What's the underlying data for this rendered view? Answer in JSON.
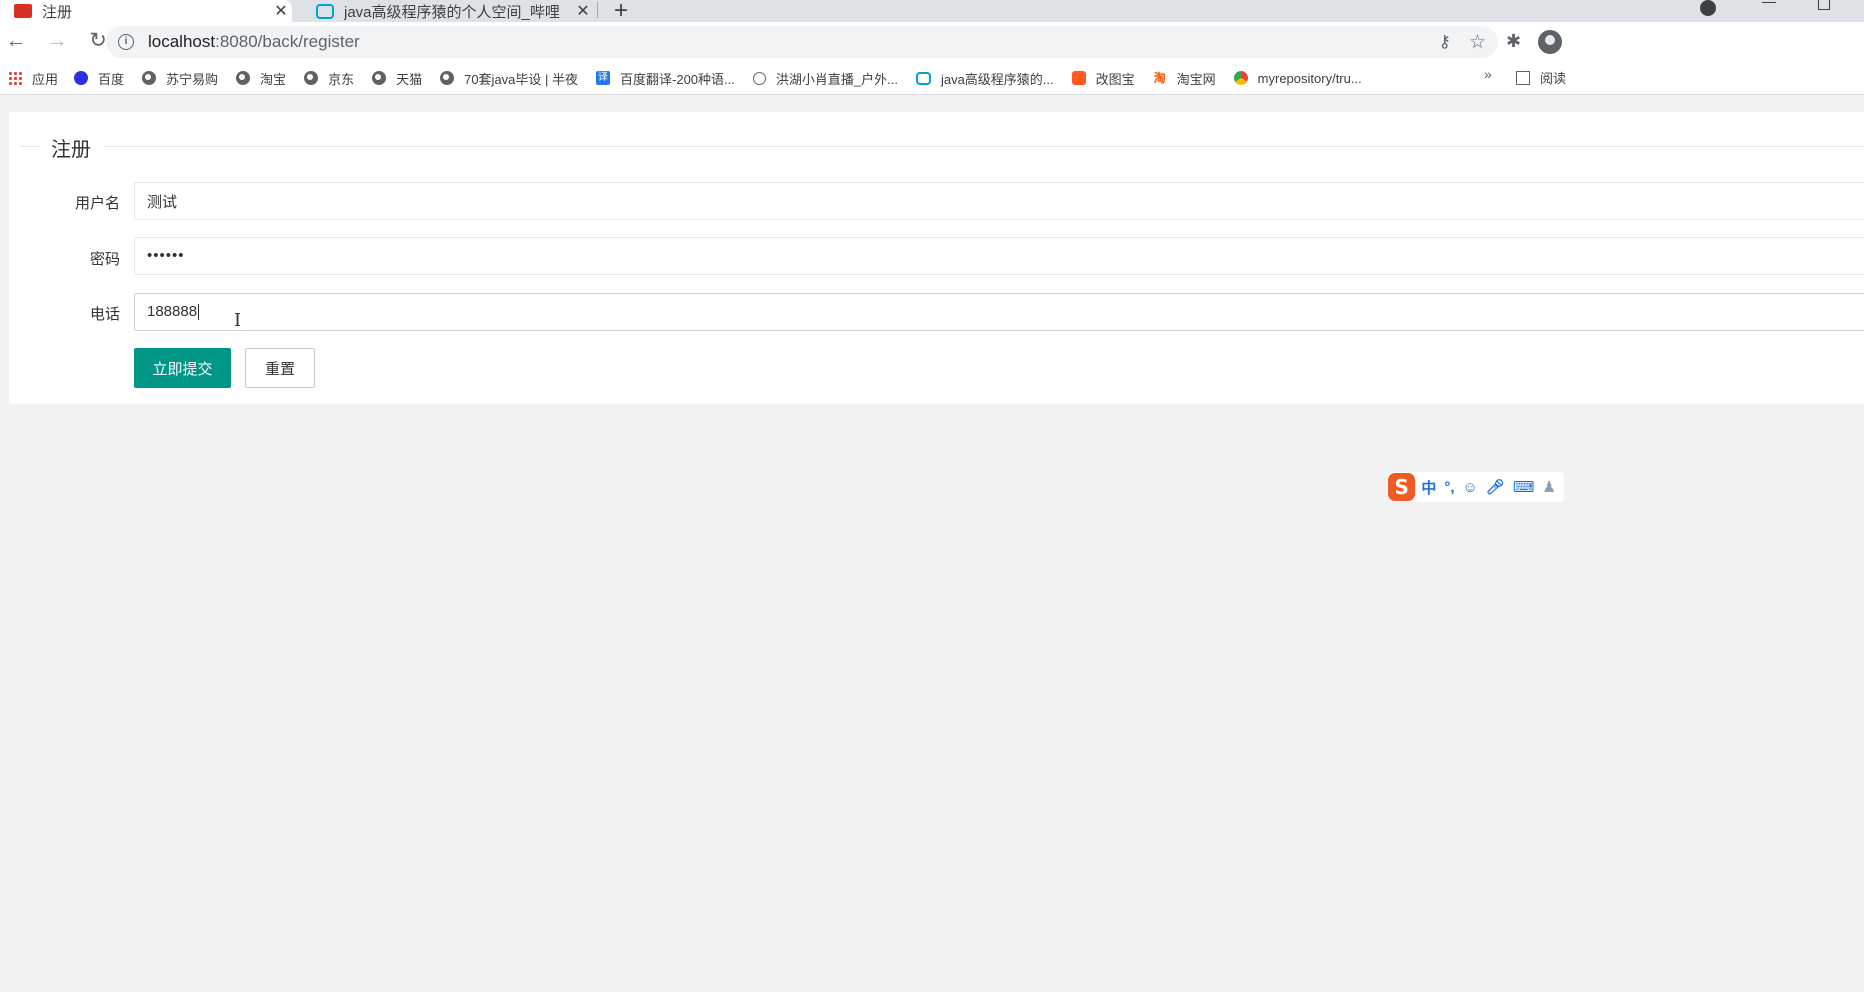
{
  "tabs": [
    {
      "title": "注册",
      "active": true
    },
    {
      "title": "java高级程序猿的个人空间_哔哩",
      "active": false
    }
  ],
  "omnibox": {
    "host": "localhost",
    "path": ":8080/back/register"
  },
  "bookmarks": [
    {
      "label": "应用",
      "icon": "apps-icon"
    },
    {
      "label": "百度",
      "icon": "baidu-icon"
    },
    {
      "label": "苏宁易购",
      "icon": "globe-icon"
    },
    {
      "label": "淘宝",
      "icon": "globe-icon"
    },
    {
      "label": "京东",
      "icon": "globe-icon"
    },
    {
      "label": "天猫",
      "icon": "globe-icon"
    },
    {
      "label": "70套java毕设 | 半夜",
      "icon": "globe-icon"
    },
    {
      "label": "百度翻译-200种语...",
      "icon": "fanyi-icon"
    },
    {
      "label": "洪湖小肖直播_户外...",
      "icon": "sport-icon"
    },
    {
      "label": "java高级程序猿的...",
      "icon": "bilibili-icon"
    },
    {
      "label": "改图宝",
      "icon": "gaitubao-icon"
    },
    {
      "label": "淘宝网",
      "icon": "taobao-icon"
    },
    {
      "label": "myrepository/tru...",
      "icon": "chrome-icon"
    }
  ],
  "bookmarks_more": "»",
  "reading_list": "阅读",
  "form": {
    "legend": "注册",
    "username_label": "用户名",
    "username_value": "测试",
    "password_label": "密码",
    "password_value": "••••••",
    "phone_label": "电话",
    "phone_value": "188888",
    "submit_label": "立即提交",
    "reset_label": "重置"
  },
  "ime": {
    "logo": "S",
    "mode": "中",
    "punct": "°,"
  },
  "colors": {
    "primary": "#009688",
    "page_bg": "#f2f2f2",
    "tab_strip": "#dee1e6"
  }
}
